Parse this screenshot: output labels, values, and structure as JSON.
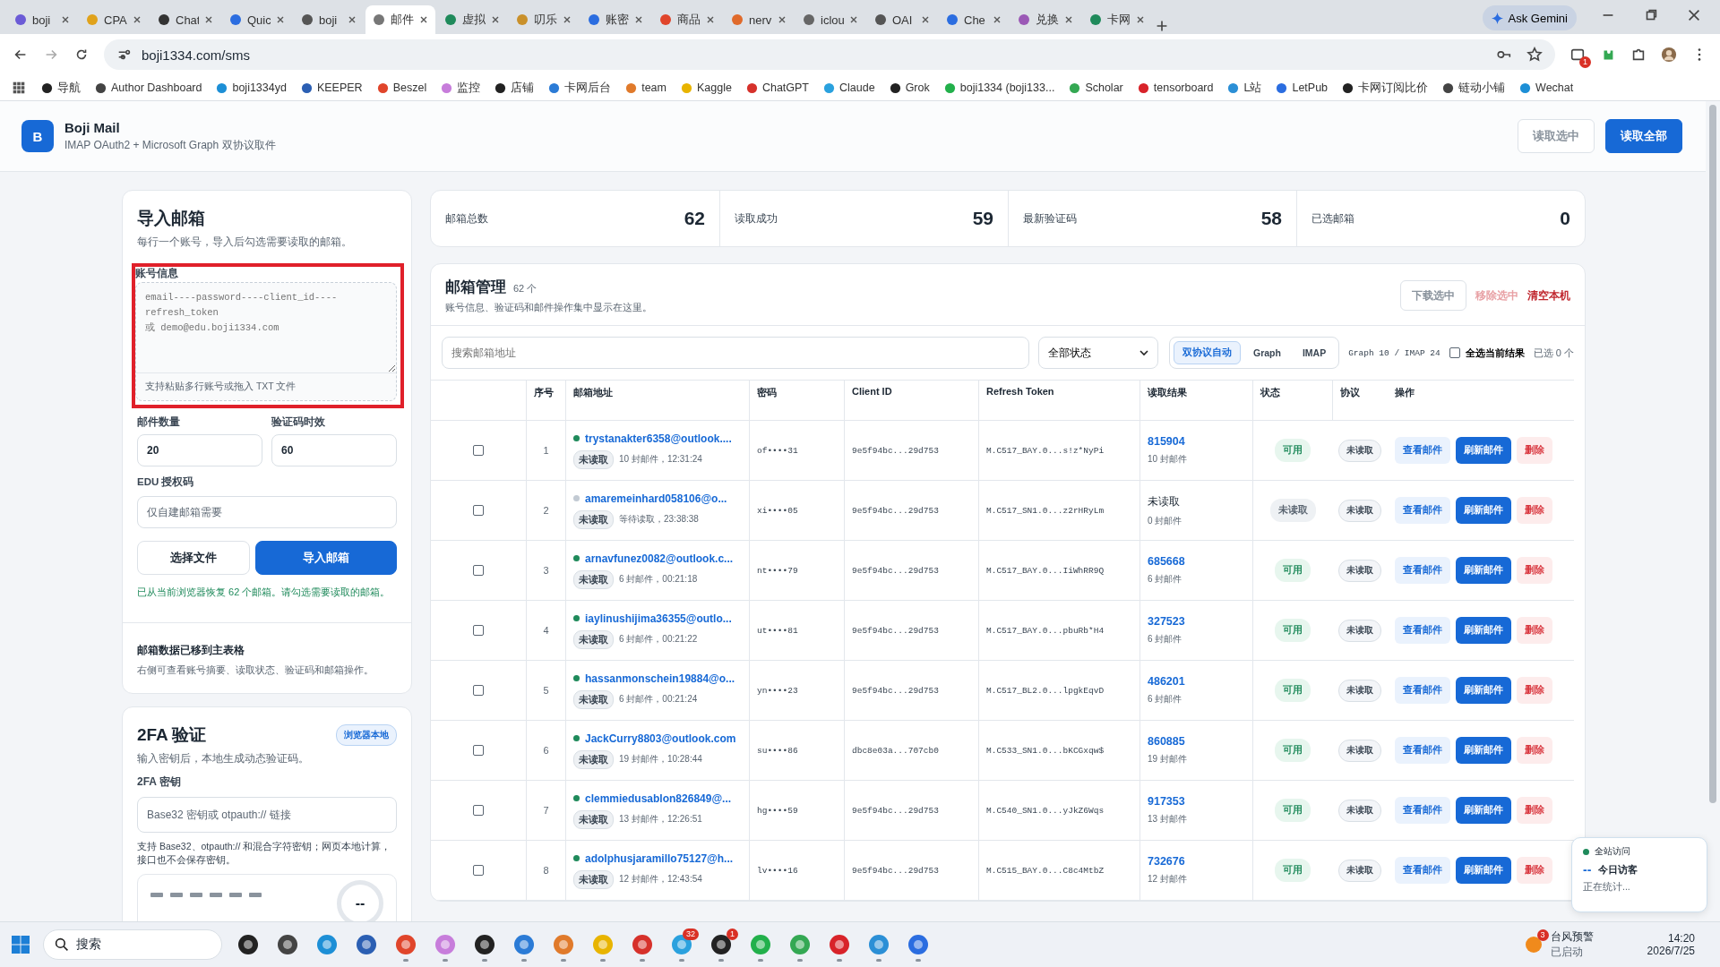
{
  "browser": {
    "tabs": [
      {
        "label": "boji",
        "selected": false
      },
      {
        "label": "CPA",
        "selected": false
      },
      {
        "label": "Chat",
        "selected": false
      },
      {
        "label": "Quic",
        "selected": false
      },
      {
        "label": "boji",
        "selected": false
      },
      {
        "label": "邮件",
        "selected": true
      },
      {
        "label": "虚拟",
        "selected": false
      },
      {
        "label": "叨乐",
        "selected": false
      },
      {
        "label": "账密",
        "selected": false
      },
      {
        "label": "商品",
        "selected": false
      },
      {
        "label": "nerv",
        "selected": false
      },
      {
        "label": "iclou",
        "selected": false
      },
      {
        "label": "OAI",
        "selected": false
      },
      {
        "label": "Che",
        "selected": false
      },
      {
        "label": "兑换",
        "selected": false
      },
      {
        "label": "卡网",
        "selected": false
      }
    ],
    "gemini_button": "Ask Gemini",
    "url": "boji1334.com/sms",
    "extension_badge": "1",
    "bookmarks": [
      "导航",
      "Author Dashboard",
      "boji1334yd",
      "KEEPER",
      "Beszel",
      "监控",
      "店铺",
      "卡网后台",
      "team",
      "Kaggle",
      "ChatGPT",
      "Claude",
      "Grok",
      "boji1334 (boji133...",
      "Scholar",
      "tensorboard",
      "L站",
      "LetPub",
      "卡网订阅比价",
      "链动小铺",
      "Wechat"
    ]
  },
  "app": {
    "logo_letter": "B",
    "title": "Boji Mail",
    "subtitle": "IMAP OAuth2 + Microsoft Graph 双协议取件",
    "actions": [
      {
        "label": "读取选中",
        "kind": "secondary"
      },
      {
        "label": "读取全部",
        "kind": "primary"
      }
    ]
  },
  "import_panel": {
    "title": "导入邮箱",
    "subtitle": "每行一个账号，导入后勾选需要读取的邮箱。",
    "account_label": "账号信息",
    "account_placeholder": "email----password----client_id----refresh_token\n或 demo@edu.boji1334.com",
    "account_hint": "支持粘贴多行账号或拖入 TXT 文件",
    "mail_count": {
      "label": "邮件数量",
      "value": "20"
    },
    "code_ttl": {
      "label": "验证码时效",
      "value": "60"
    },
    "edu": {
      "label": "EDU 授权码",
      "placeholder": "仅自建邮箱需要"
    },
    "buttons": [
      {
        "label": "选择文件",
        "kind": "secondary"
      },
      {
        "label": "导入邮箱",
        "kind": "primary"
      }
    ],
    "notice": "已从当前浏览器恢复 62 个邮箱。请勾选需要读取的邮箱。",
    "moved_title": "邮箱数据已移到主表格",
    "moved_text": "右侧可查看账号摘要、读取状态、验证码和邮箱操作。"
  },
  "twofa_panel": {
    "title": "2FA 验证",
    "badge": "浏览器本地",
    "subtitle": "输入密钥后，本地生成动态验证码。",
    "key_label": "2FA 密钥",
    "key_placeholder": "Base32 密钥或 otpauth:// 链接",
    "note": "支持 Base32、otpauth:// 和混合字符密钥；网页本地计算，接口也不会保存密钥。",
    "countdown": "--"
  },
  "stats": [
    {
      "label": "邮箱总数",
      "value": "62"
    },
    {
      "label": "读取成功",
      "value": "59"
    },
    {
      "label": "最新验证码",
      "value": "58"
    },
    {
      "label": "已选邮箱",
      "value": "0"
    }
  ],
  "mailbox_manager": {
    "title": "邮箱管理",
    "count": "62 个",
    "subtitle": "账号信息、验证码和邮件操作集中显示在这里。",
    "actions": [
      {
        "label": "下载选中",
        "kind": "outline"
      },
      {
        "label": "移除选中",
        "kind": "muted-danger"
      },
      {
        "label": "清空本机",
        "kind": "danger"
      }
    ],
    "search_placeholder": "搜索邮箱地址",
    "status_filter": "全部状态",
    "protocol_modes": [
      {
        "label": "双协议自动",
        "selected": true
      },
      {
        "label": "Graph",
        "selected": false
      },
      {
        "label": "IMAP",
        "selected": false
      }
    ],
    "protocol_counts": "Graph 10 / IMAP 24",
    "select_all": {
      "label": "全选当前结果",
      "checked": false
    },
    "selected_count": "已选 0 个",
    "table": {
      "columns": [
        "序号",
        "邮箱地址",
        "密码",
        "Client ID",
        "Refresh Token",
        "读取结果",
        "状态",
        "协议",
        "操作"
      ],
      "rows": [
        {
          "checked": false,
          "index": "1",
          "email": "trystanakter6358@outlook....",
          "color": "#1f8a5b",
          "tag": "未读取",
          "meta": "10 封邮件，12:31:24",
          "password": "of••••31",
          "client_id": "9e5f94bc...29d753",
          "refresh_token": "M.C517_BAY.0...s!z*NyPi",
          "result": "815904",
          "kind": "read",
          "result_count": "10 封邮件",
          "status": "可用",
          "protocol": "未读取",
          "actions": [
            "查看邮件",
            "刷新邮件",
            "删除"
          ]
        },
        {
          "checked": false,
          "index": "2",
          "email": "amaremeinhard058106@o...",
          "color": "#c2cad3",
          "tag": "未读取",
          "meta": "等待读取，23:38:38",
          "password": "xi••••05",
          "client_id": "9e5f94bc...29d753",
          "refresh_token": "M.C517_SN1.0...z2rHRyLm",
          "result": "未读取",
          "kind": "pending",
          "result_count": "0 封邮件",
          "status": "未读取",
          "protocol": "未读取",
          "actions": [
            "查看邮件",
            "刷新邮件",
            "删除"
          ]
        },
        {
          "checked": false,
          "index": "3",
          "email": "arnavfunez0082@outlook.c...",
          "color": "#1f8a5b",
          "tag": "未读取",
          "meta": "6 封邮件，00:21:18",
          "password": "nt••••79",
          "client_id": "9e5f94bc...29d753",
          "refresh_token": "M.C517_BAY.0...IiWhRR9Q",
          "result": "685668",
          "kind": "read",
          "result_count": "6 封邮件",
          "status": "可用",
          "protocol": "未读取",
          "actions": [
            "查看邮件",
            "刷新邮件",
            "删除"
          ]
        },
        {
          "checked": false,
          "index": "4",
          "email": "iaylinushijima36355@outlo...",
          "color": "#1f8a5b",
          "tag": "未读取",
          "meta": "6 封邮件，00:21:22",
          "password": "ut••••81",
          "client_id": "9e5f94bc...29d753",
          "refresh_token": "M.C517_BAY.0...pbuRb*H4",
          "result": "327523",
          "kind": "read",
          "result_count": "6 封邮件",
          "status": "可用",
          "protocol": "未读取",
          "actions": [
            "查看邮件",
            "刷新邮件",
            "删除"
          ]
        },
        {
          "checked": false,
          "index": "5",
          "email": "hassanmonschein19884@o...",
          "color": "#1f8a5b",
          "tag": "未读取",
          "meta": "6 封邮件，00:21:24",
          "password": "yn••••23",
          "client_id": "9e5f94bc...29d753",
          "refresh_token": "M.C517_BL2.0...lpgkEqvD",
          "result": "486201",
          "kind": "read",
          "result_count": "6 封邮件",
          "status": "可用",
          "protocol": "未读取",
          "actions": [
            "查看邮件",
            "刷新邮件",
            "删除"
          ]
        },
        {
          "checked": false,
          "index": "6",
          "email": "JackCurry8803@outlook.com",
          "color": "#1f8a5b",
          "tag": "未读取",
          "meta": "19 封邮件，10:28:44",
          "password": "su••••86",
          "client_id": "dbc8e03a...707cb0",
          "refresh_token": "M.C533_SN1.0...bKCGxqw$",
          "result": "860885",
          "kind": "read",
          "result_count": "19 封邮件",
          "status": "可用",
          "protocol": "未读取",
          "actions": [
            "查看邮件",
            "刷新邮件",
            "删除"
          ]
        },
        {
          "checked": false,
          "index": "7",
          "email": "clemmiedusablon826849@...",
          "color": "#1f8a5b",
          "tag": "未读取",
          "meta": "13 封邮件，12:26:51",
          "password": "hg••••59",
          "client_id": "9e5f94bc...29d753",
          "refresh_token": "M.C540_SN1.0...yJkZ6Wqs",
          "result": "917353",
          "kind": "read",
          "result_count": "13 封邮件",
          "status": "可用",
          "protocol": "未读取",
          "actions": [
            "查看邮件",
            "刷新邮件",
            "删除"
          ]
        },
        {
          "checked": false,
          "index": "8",
          "email": "adolphusjaramillo75127@h...",
          "color": "#1f8a5b",
          "tag": "未读取",
          "meta": "12 封邮件，12:43:54",
          "password": "lv••••16",
          "client_id": "9e5f94bc...29d753",
          "refresh_token": "M.C515_BAY.0...C8c4MtbZ",
          "result": "732676",
          "kind": "read",
          "result_count": "12 封邮件",
          "status": "可用",
          "protocol": "未读取",
          "actions": [
            "查看邮件",
            "刷新邮件",
            "删除"
          ]
        }
      ]
    }
  },
  "visitor_widget": {
    "title": "全站访问",
    "value": "--",
    "label": "今日访客",
    "note": "正在统计..."
  },
  "taskbar": {
    "search_placeholder": "搜索",
    "apps": [
      {
        "running": false
      },
      {
        "running": false
      },
      {
        "running": false
      },
      {
        "running": false
      },
      {
        "running": true
      },
      {
        "running": true
      },
      {
        "running": true
      },
      {
        "running": true
      },
      {
        "running": true
      },
      {
        "running": true
      },
      {
        "running": true
      },
      {
        "running": true,
        "badge": "32"
      },
      {
        "running": true,
        "badge": "1"
      },
      {
        "running": true
      },
      {
        "running": true
      },
      {
        "running": true
      },
      {
        "running": true
      },
      {
        "running": true
      }
    ],
    "weather_badge": "3",
    "weather_title": "台风预警",
    "weather_sub": "已启动",
    "time": "14:20",
    "date": "2026/7/25"
  }
}
